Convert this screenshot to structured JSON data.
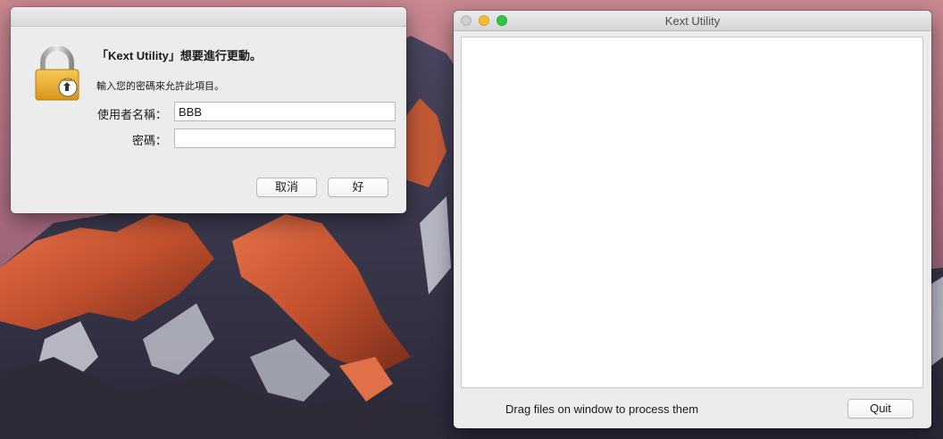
{
  "auth_dialog": {
    "title": "「Kext Utility」想要進行更動。",
    "message": "輸入您的密碼來允許此項目。",
    "username_label": "使用者名稱：",
    "username_value": "BBB",
    "password_label": "密碼：",
    "password_value": "",
    "cancel_label": "取消",
    "ok_label": "好",
    "icon": "lock-icon"
  },
  "kext_window": {
    "title": "Kext Utility",
    "status": "Drag files on window to process them",
    "quit_label": "Quit",
    "traffic_lights": {
      "close_color": "#d0d0d0",
      "minimize_color": "#f5bc31",
      "zoom_color": "#33c748"
    }
  }
}
